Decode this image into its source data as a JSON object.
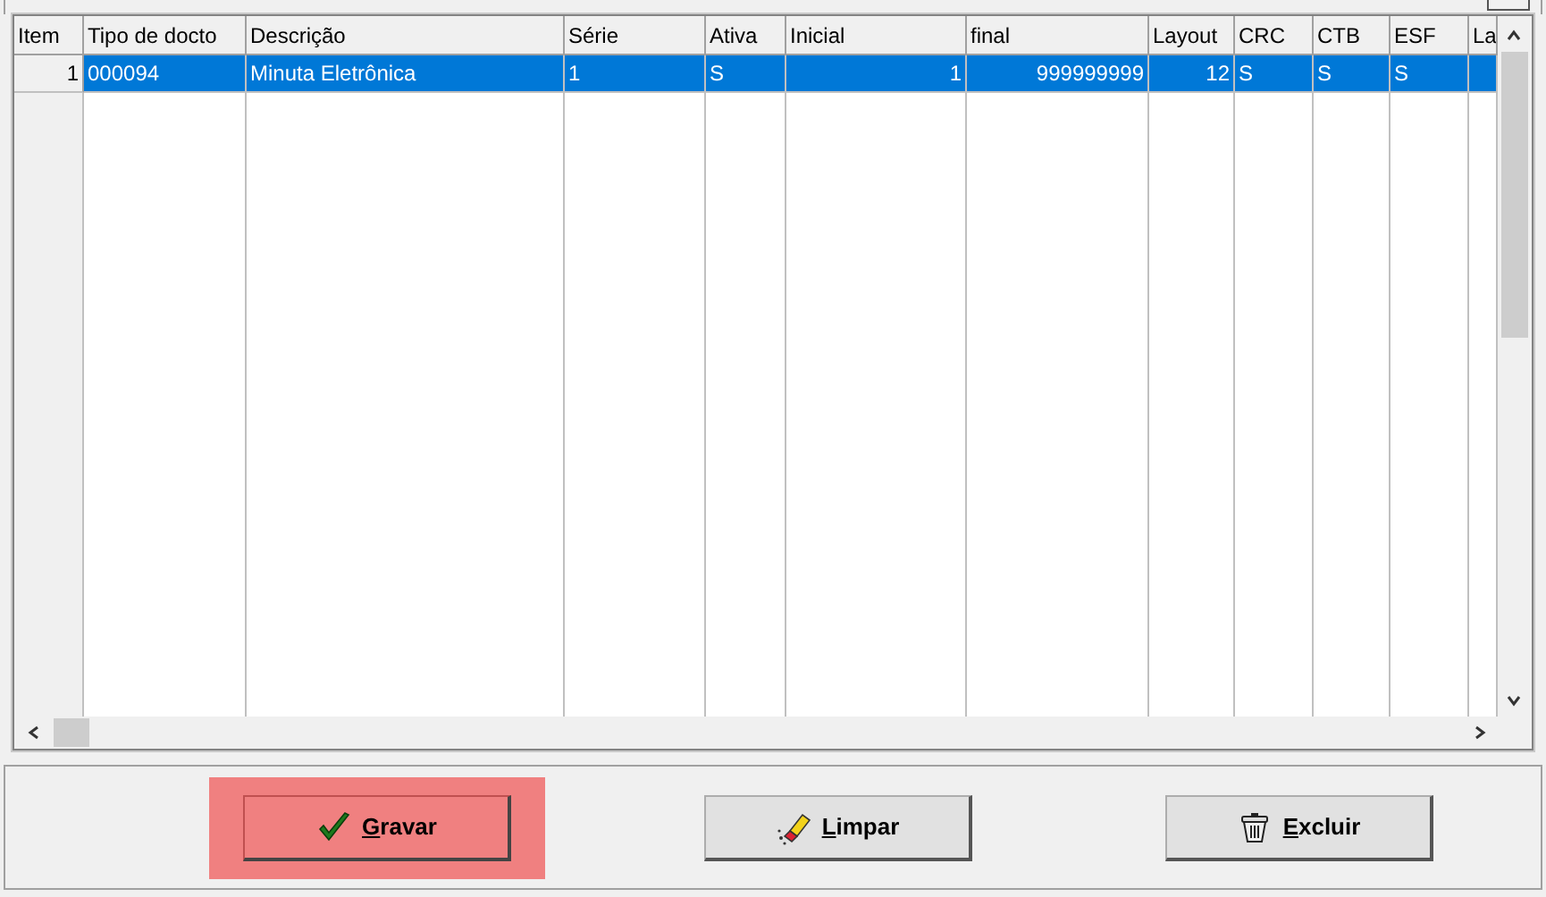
{
  "table": {
    "columns": [
      "Item",
      "Tipo de docto",
      "Descrição",
      "Série",
      "Ativa",
      "Inicial",
      "final",
      "Layout",
      "CRC",
      "CTB",
      "ESF",
      "La"
    ],
    "rows": [
      {
        "selected": true,
        "cells": [
          "1",
          "000094",
          "Minuta Eletrônica",
          "1",
          "S",
          "1",
          "999999999",
          "12",
          "S",
          "S",
          "S",
          ""
        ]
      }
    ]
  },
  "buttons": [
    {
      "kind": "save",
      "accel": "G",
      "rest": "ravar",
      "highlighted": true
    },
    {
      "kind": "clear",
      "accel": "L",
      "rest": "impar",
      "highlighted": false
    },
    {
      "kind": "delete",
      "accel": "E",
      "rest": "xcluir",
      "highlighted": false
    }
  ]
}
